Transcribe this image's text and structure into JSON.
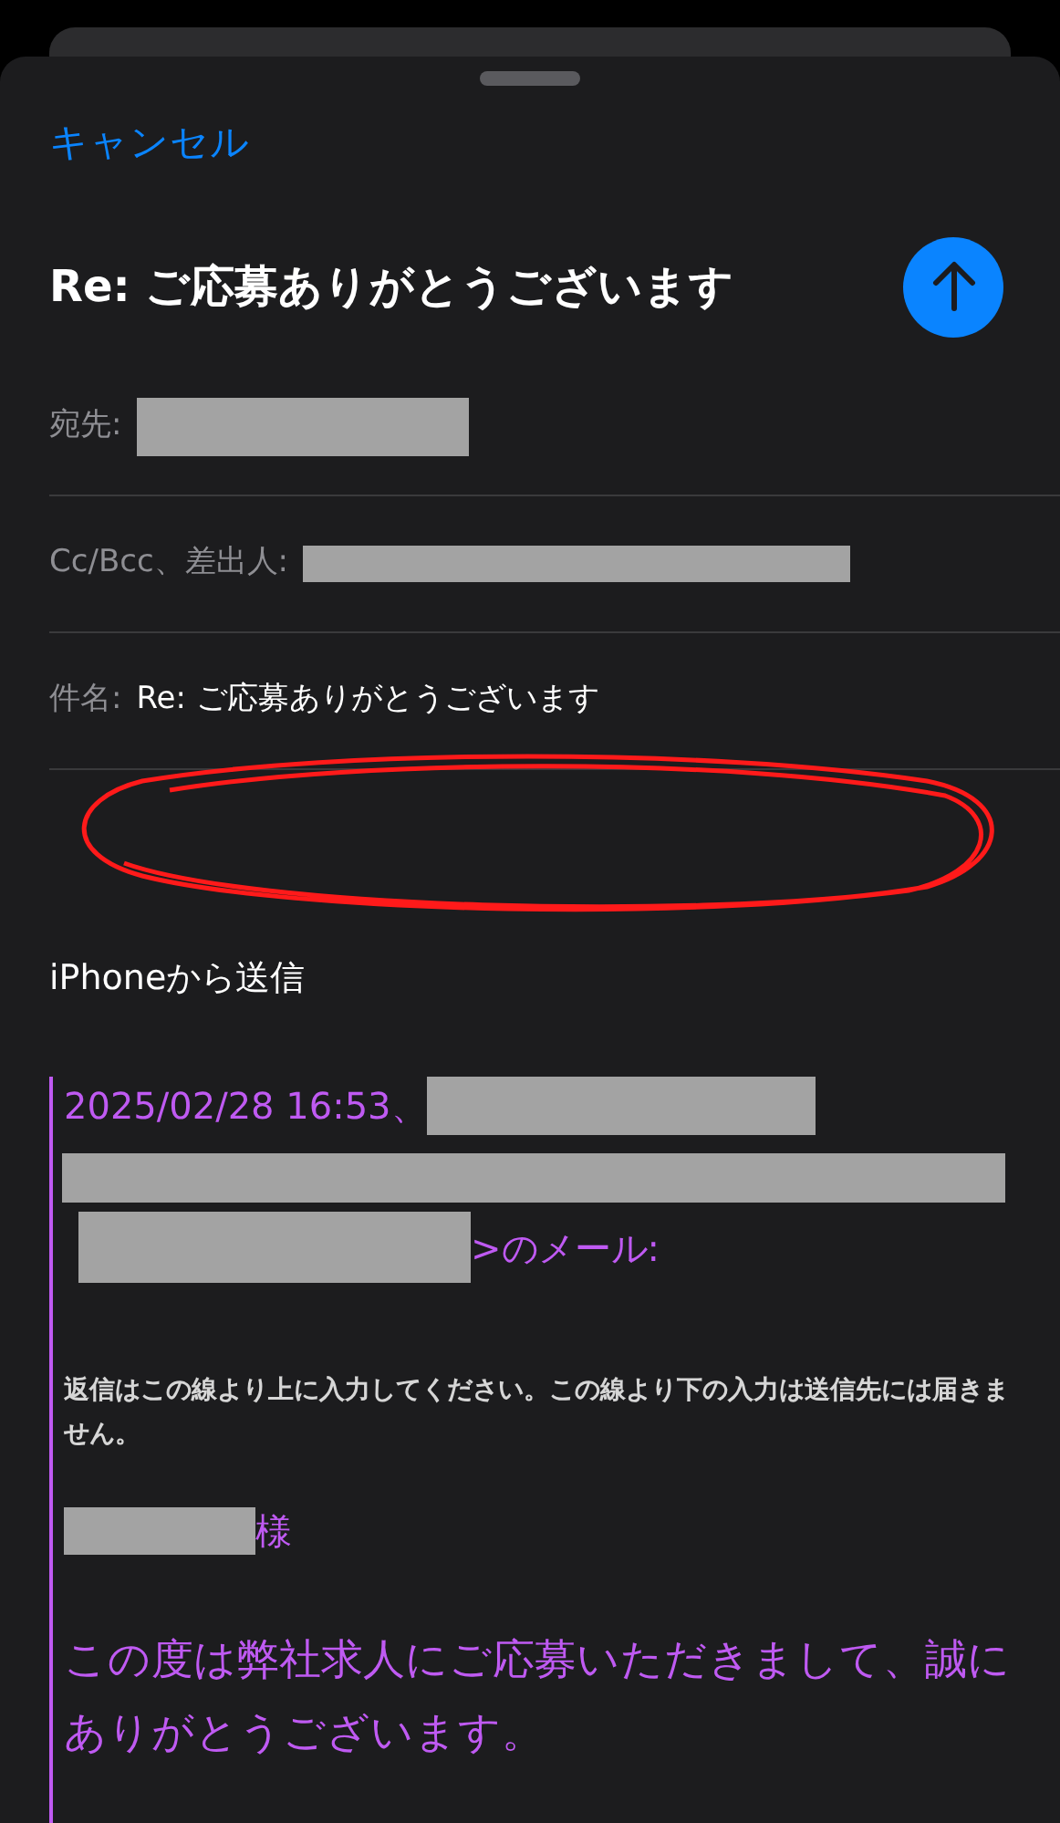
{
  "compose": {
    "cancel": "キャンセル",
    "title": "Re: ご応募ありがとうございます"
  },
  "fields": [
    {
      "label": "宛先:"
    },
    {
      "label": "Cc/Bcc、差出人:"
    },
    {
      "label": "件名:",
      "value": "Re: ご応募ありがとうございます"
    }
  ],
  "body": {
    "signature": "iPhoneから送信"
  },
  "quote": {
    "header": "2025/02/28 16:53、",
    "mail_suffix": ">のメール:",
    "notice": "返信はこの線より上に入力してください。この線より下の入力は送信先には届きません。",
    "salutation_suffix": "様",
    "message": "この度は弊社求人にご応募いただきまして、誠にありがとうございます。"
  }
}
